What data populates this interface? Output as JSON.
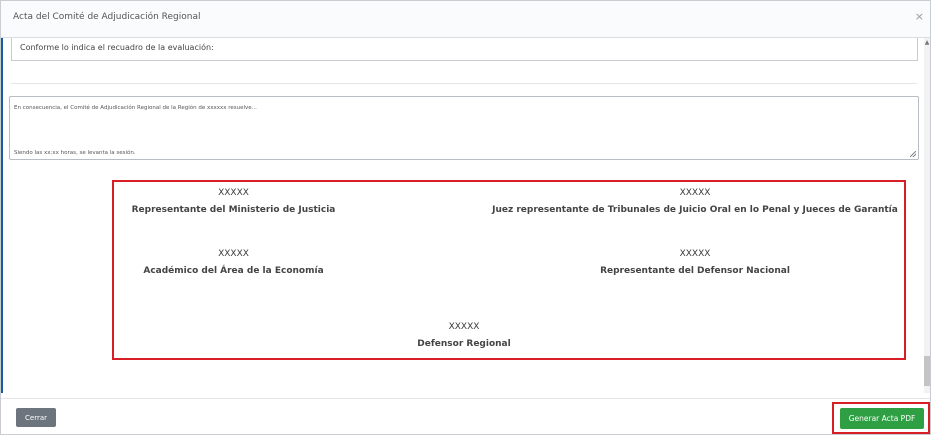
{
  "modal": {
    "title": "Acta del Comité de Adjudicación Regional",
    "close_symbol": "×",
    "scroll_up_symbol": "▲"
  },
  "evaluation_box": {
    "text": "Conforme lo indica el recuadro de la evaluación:"
  },
  "resolution_textarea": {
    "line1": "En consecuencia, el Comité de Adjudicación Regional de la Región de xxxxxx resuelve...",
    "line2": "Siendo las xx:xx horas, se levanta la sesión."
  },
  "signatories": [
    {
      "name": "XXXXX",
      "role": "Representante del Ministerio de Justicia"
    },
    {
      "name": "XXXXX",
      "role": "Juez representante de Tribunales de Juicio Oral en lo Penal y Jueces de Garantía"
    },
    {
      "name": "XXXXX",
      "role": "Académico del Área de la Economía"
    },
    {
      "name": "XXXXX",
      "role": "Representante del Defensor Nacional"
    },
    {
      "name": "XXXXX",
      "role": "Defensor Regional"
    }
  ],
  "footer": {
    "close_label": "Cerrar",
    "generate_pdf_label": "Generar Acta PDF"
  },
  "colors": {
    "highlight": "#d81f26",
    "primary_button": "#2ea043",
    "secondary_button": "#6c757d",
    "accent": "#1a5aa0"
  }
}
